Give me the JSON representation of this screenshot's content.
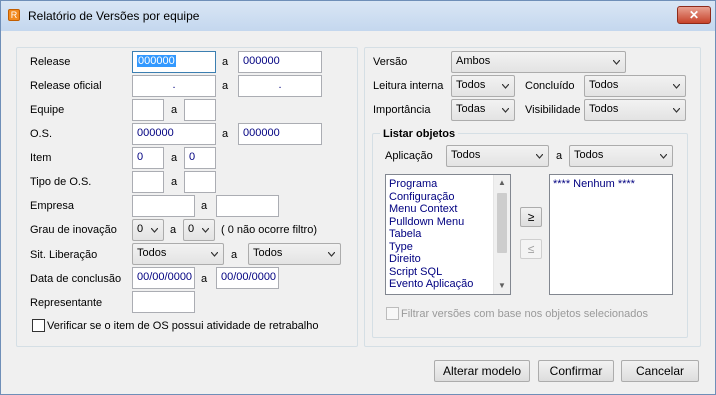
{
  "window": {
    "title": "Relatório de Versões por equipe",
    "close_label": "✕",
    "app_icon_glyph": "R"
  },
  "left": {
    "release": {
      "label": "Release",
      "from": "000000",
      "sep": "a",
      "to": "000000"
    },
    "release_oficial": {
      "label": "Release oficial",
      "from": ".",
      "sep": "a",
      "to": "."
    },
    "equipe": {
      "label": "Equipe",
      "from": "",
      "sep": "a",
      "to": ""
    },
    "os": {
      "label": "O.S.",
      "from": "000000",
      "sep": "a",
      "to": "000000"
    },
    "item": {
      "label": "Item",
      "from": "0",
      "sep": "a",
      "to": "0"
    },
    "tipo_os": {
      "label": "Tipo de O.S.",
      "from": "",
      "sep": "a",
      "to": ""
    },
    "empresa": {
      "label": "Empresa",
      "from": "",
      "sep": "a",
      "to": ""
    },
    "grau": {
      "label": "Grau de inovação",
      "from": "0",
      "sep": "a",
      "to": "0",
      "note": "( 0 não ocorre filtro)"
    },
    "sit_liberacao": {
      "label": "Sit. Liberação",
      "from": "Todos",
      "sep": "a",
      "to": "Todos"
    },
    "data_conclusao": {
      "label": "Data de conclusão",
      "from": "00/00/0000",
      "sep": "a",
      "to": "00/00/0000"
    },
    "representante": {
      "label": "Representante",
      "value": ""
    },
    "retrabalho": {
      "label": "Verificar se o item de OS possui atividade de retrabalho",
      "checked": false
    }
  },
  "right": {
    "versao": {
      "label": "Versão",
      "value": "Ambos"
    },
    "leitura_interna": {
      "label": "Leitura interna",
      "value": "Todos"
    },
    "concluido": {
      "label": "Concluído",
      "value": "Todos"
    },
    "importancia": {
      "label": "Importância",
      "value": "Todas"
    },
    "visibilidade": {
      "label": "Visibilidade",
      "value": "Todos"
    },
    "listar_objetos": {
      "title": "Listar objetos",
      "aplicacao": {
        "label": "Aplicação",
        "from": "Todos",
        "sep": "a",
        "to": "Todos"
      },
      "available": [
        "Programa",
        "Configuração",
        "Menu Context",
        "Pulldown Menu",
        "Tabela",
        "Type",
        "Direito",
        "Script SQL",
        "Evento Aplicação"
      ],
      "selected": [
        "**** Nenhum ****"
      ],
      "add_label": "≥",
      "remove_label": "≤",
      "filter": {
        "label": "Filtrar versões com base nos objetos selecionados",
        "checked": false
      }
    }
  },
  "footer": {
    "alterar": "Alterar modelo",
    "confirmar": "Confirmar",
    "cancelar": "Cancelar"
  }
}
